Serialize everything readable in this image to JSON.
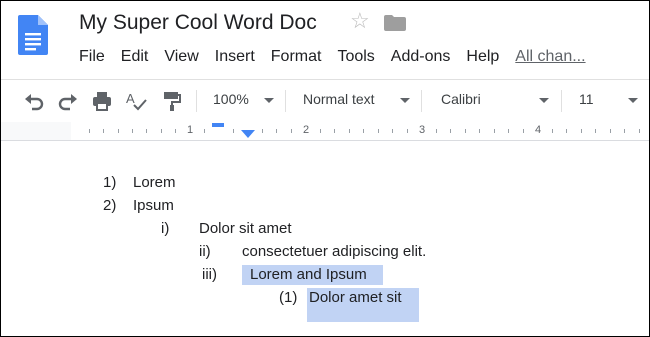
{
  "document": {
    "title": "My Super Cool Word Doc"
  },
  "menu": {
    "items": [
      "File",
      "Edit",
      "View",
      "Insert",
      "Format",
      "Tools",
      "Add-ons",
      "Help"
    ],
    "all_changes": "All chan..."
  },
  "toolbar": {
    "zoom": "100%",
    "style": "Normal text",
    "font": "Calibri",
    "size": "11"
  },
  "ruler": {
    "numbers": [
      "1",
      "2",
      "3",
      "4"
    ]
  },
  "content": {
    "lines": [
      {
        "marker": "1)",
        "text": "Lorem"
      },
      {
        "marker": "2)",
        "text": "Ipsum"
      },
      {
        "marker": "i)",
        "text": "Dolor sit amet"
      },
      {
        "marker": "ii)",
        "text": "consectetuer adipiscing elit."
      },
      {
        "marker": "iii)",
        "text": "Lorem and Ipsum"
      },
      {
        "marker": "(1)",
        "text": "Dolor amet sit"
      }
    ]
  },
  "colors": {
    "highlight": "#c1d3f4",
    "accent": "#4285f4",
    "logo": "#4285f4"
  },
  "icons": [
    "docs-logo-icon",
    "star-icon",
    "folder-icon",
    "undo-icon",
    "redo-icon",
    "print-icon",
    "spellcheck-icon",
    "paint-format-icon",
    "chevron-down-icon"
  ]
}
